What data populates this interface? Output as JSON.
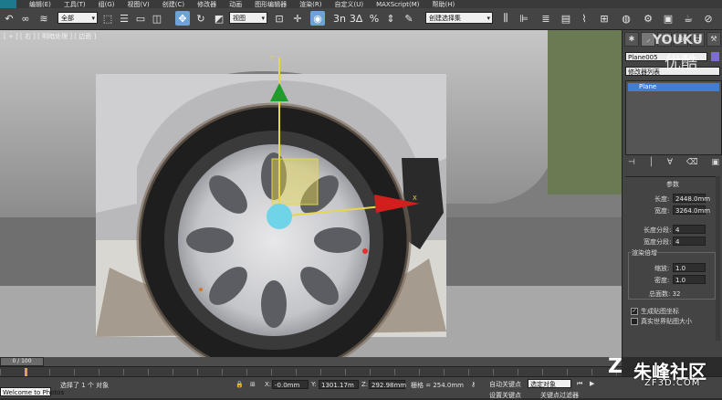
{
  "menu": {
    "items": [
      "编辑(E)",
      "工具(T)",
      "组(G)",
      "视图(V)",
      "创建(C)",
      "修改器",
      "动画",
      "图形编辑器",
      "渲染(R)",
      "自定义(U)",
      "MAXScript(M)",
      "帮助(H)"
    ]
  },
  "toolbar": {
    "selection_filter": "全部",
    "ref_coord": "视图",
    "named_selection": "创建选择集",
    "snap_count": "3",
    "snap_angle": "3"
  },
  "viewport": {
    "label": "[ + ] [ 右 ] [ 明暗处理 ] [ 边面 ]",
    "gizmo": {
      "x_axis": "X",
      "y_axis": "Y"
    }
  },
  "command_panel": {
    "object_name": "Plane005",
    "modifier_list": "修改器列表",
    "stack_items": [
      "Plane"
    ],
    "rollout_title": "参数",
    "params": [
      {
        "label": "长度:",
        "value": "2448.0mm"
      },
      {
        "label": "宽度:",
        "value": "3264.0mm"
      }
    ],
    "segs": [
      {
        "label": "长度分段:",
        "value": "4"
      },
      {
        "label": "宽度分段:",
        "value": "4"
      }
    ],
    "render_group": "渲染倍增",
    "render_params": [
      {
        "label": "缩放:",
        "value": "1.0"
      },
      {
        "label": "密度:",
        "value": "1.0"
      }
    ],
    "total_faces": "总面数: 32",
    "checkboxes": [
      {
        "label": "生成贴图坐标",
        "checked": true
      },
      {
        "label": "真实世界贴图大小",
        "checked": false
      }
    ]
  },
  "timeline": {
    "frame": "0 / 100"
  },
  "status": {
    "prompt": "选择了 1 个 对象",
    "welcome": "Welcome to Photos",
    "x_label": "X:",
    "x_value": "-0.0mm",
    "y_label": "Y:",
    "y_value": "1301.17m",
    "z_label": "Z:",
    "z_value": "292.98mm",
    "grid": "栅格 = 254.0mm",
    "auto_key": "自动关键点",
    "key_filter": "选定对象",
    "set_key": "设置关键点",
    "key_filters_btn": "关键点过滤器"
  },
  "watermarks": {
    "youku_top": "YOUKU",
    "youku_bottom": "优酷",
    "community": "朱峰社区",
    "site": "ZF3D.COM"
  },
  "colors": {
    "x_axis": "#d31e1e",
    "y_axis": "#1f9c2c",
    "gizmo_plane": "#e6d64a",
    "pivot": "#6fd4e8",
    "selection_blue": "#3d7fd4"
  }
}
